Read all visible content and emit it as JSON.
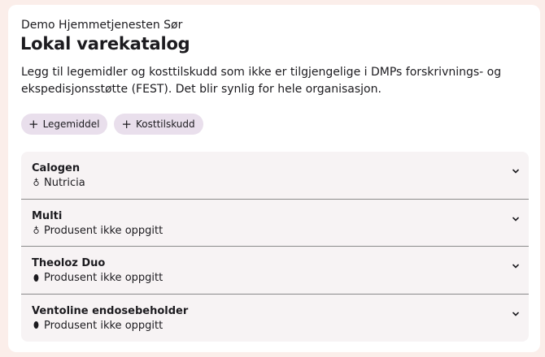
{
  "header": {
    "organization": "Demo Hjemmetjenesten Sør",
    "title": "Lokal varekatalog",
    "description": "Legg til legemidler og kosttilskudd som ikke er tilgjengelige i DMPs forskrivnings- og ekspedisjonsstøtte (FEST). Det blir synlig for hele organisasjon."
  },
  "actions": [
    {
      "label": "Legemiddel",
      "icon": "plus-icon"
    },
    {
      "label": "Kosttilskudd",
      "icon": "plus-icon"
    }
  ],
  "items": [
    {
      "name": "Calogen",
      "manufacturer": "Nutricia",
      "icon": "bottle-icon",
      "glyph": "♁"
    },
    {
      "name": "Multi",
      "manufacturer": "Produsent ikke oppgitt",
      "icon": "bottle-icon",
      "glyph": "♁"
    },
    {
      "name": "Theoloz Duo",
      "manufacturer": "Produsent ikke oppgitt",
      "icon": "pill-icon",
      "glyph": "⬮"
    },
    {
      "name": "Ventoline endosebeholder",
      "manufacturer": "Produsent ikke oppgitt",
      "icon": "pill-icon",
      "glyph": "⬮"
    }
  ]
}
